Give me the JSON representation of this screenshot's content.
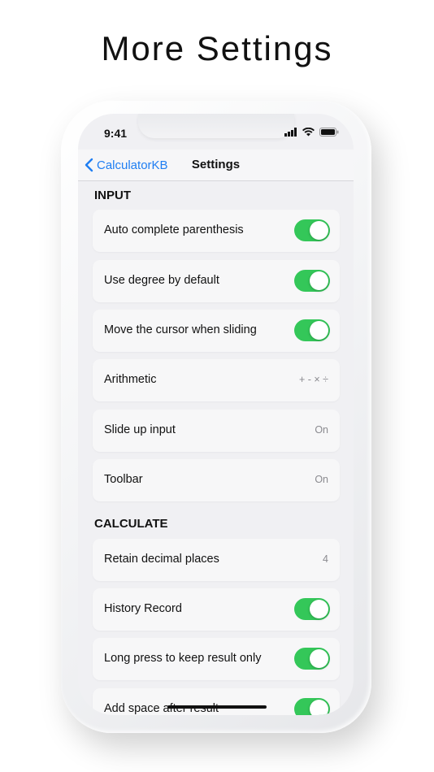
{
  "headline": "More Settings",
  "status_bar": {
    "time": "9:41"
  },
  "navbar": {
    "back_label": "CalculatorKB",
    "title": "Settings"
  },
  "sections": {
    "input": {
      "header": "INPUT",
      "rows": [
        {
          "label": "Auto complete parenthesis",
          "toggle": true
        },
        {
          "label": "Use degree by default",
          "toggle": true
        },
        {
          "label": "Move the cursor when sliding",
          "toggle": true
        },
        {
          "label": "Arithmetic",
          "value": "+ - × ÷"
        },
        {
          "label": "Slide up input",
          "value": "On"
        },
        {
          "label": "Toolbar",
          "value": "On"
        }
      ]
    },
    "calculate": {
      "header": "CALCULATE",
      "rows": [
        {
          "label": "Retain decimal places",
          "value": "4"
        },
        {
          "label": "History Record",
          "toggle": true
        },
        {
          "label": "Long press to keep result only",
          "toggle": true
        },
        {
          "label": "Add space after result",
          "toggle": true
        }
      ]
    }
  },
  "colors": {
    "accent": "#1f7ef2",
    "toggle_on": "#34c759"
  }
}
